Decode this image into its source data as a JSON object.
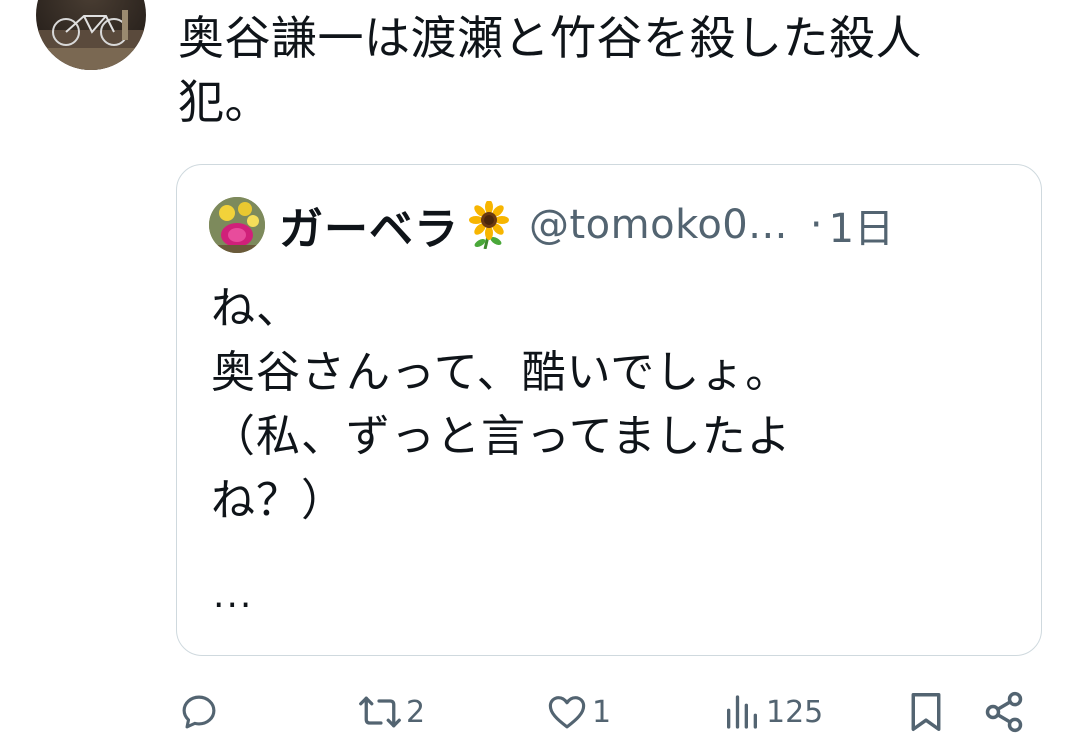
{
  "post": {
    "text": "奥谷謙一は渡瀬と竹谷を殺した殺人\n犯。"
  },
  "quote": {
    "display_name": "ガーベラ",
    "badge_icon": "sunflower-emoji",
    "handle": "@tomoko0...",
    "separator": "·",
    "time": "1日",
    "text": "ね、\n奥谷さんって、酷いでしょ。\n（私、ずっと言ってましたよ\nね？）",
    "more": "..."
  },
  "actions": {
    "reply": {
      "icon": "reply-icon",
      "count": ""
    },
    "repost": {
      "icon": "repost-icon",
      "count": "2"
    },
    "like": {
      "icon": "heart-icon",
      "count": "1"
    },
    "views": {
      "icon": "views-icon",
      "count": "125"
    },
    "bookmark": {
      "icon": "bookmark-icon"
    },
    "share": {
      "icon": "share-icon"
    }
  },
  "colors": {
    "text": "#0f1419",
    "secondary": "#536471",
    "border": "#cfd9de"
  }
}
